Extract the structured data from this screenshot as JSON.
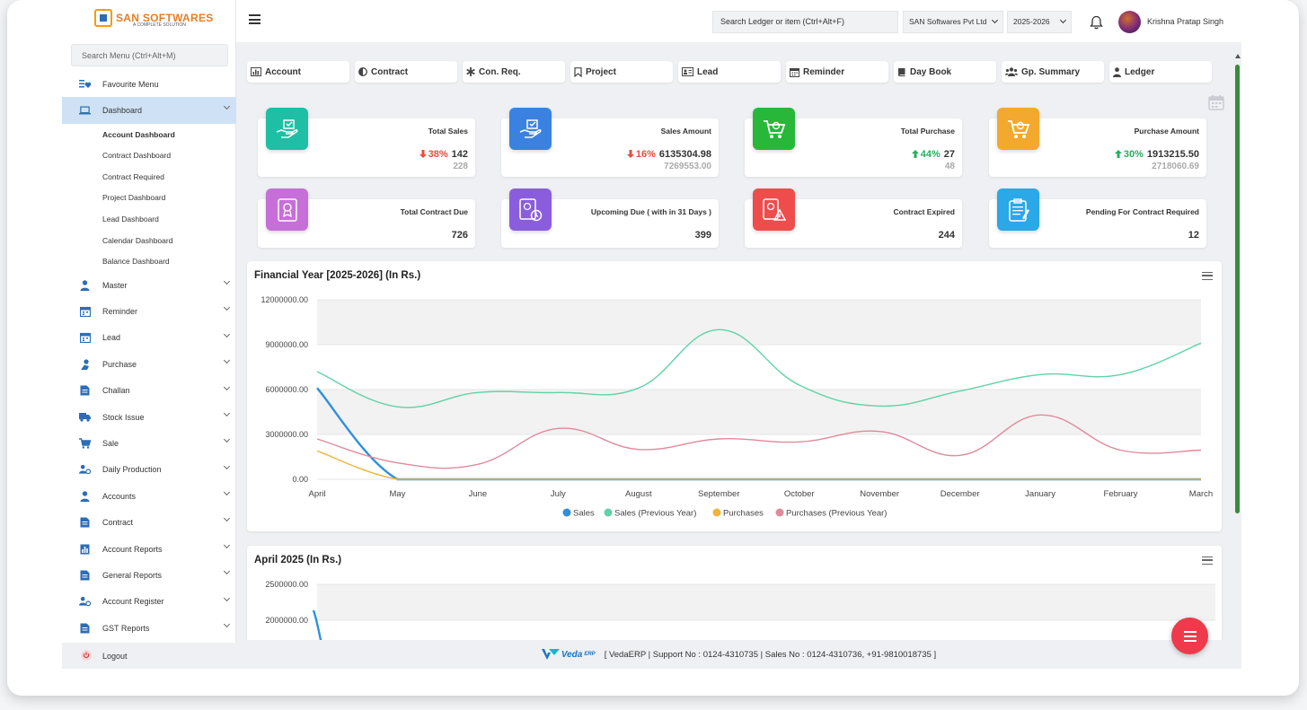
{
  "logo": {
    "text": "SAN SOFTWARES",
    "tagline": "A COMPLETE SOLUTION"
  },
  "sidebar": {
    "search_placeholder": "Search Menu (Ctrl+Alt+M)",
    "favourite": "Favourite Menu",
    "dashboard": "Dashboard",
    "dashboard_subitems": [
      "Account Dashboard",
      "Contract Dashboard",
      "Contract Required",
      "Project Dashboard",
      "Lead Dashboard",
      "Calendar Dashboard",
      "Balance Dashboard"
    ],
    "items": [
      "Master",
      "Reminder",
      "Lead",
      "Purchase",
      "Challan",
      "Stock Issue",
      "Sale",
      "Daily Production",
      "Accounts",
      "Contract",
      "Account Reports",
      "General Reports",
      "Account Register",
      "GST Reports"
    ],
    "logout": "Logout"
  },
  "topbar": {
    "search_placeholder": "Search Ledger or item (Ctrl+Alt+F)",
    "company": "SAN Softwares Pvt Ltd",
    "year": "2025-2026",
    "user": "Krishna Pratap Singh"
  },
  "tabs": [
    "Account",
    "Contract",
    "Con. Req.",
    "Project",
    "Lead",
    "Reminder",
    "Day Book",
    "Gp. Summary",
    "Ledger"
  ],
  "cards": [
    {
      "title": "Total Sales",
      "pct": "38%",
      "dir": "down",
      "value": "142",
      "prev": "228",
      "color": "#1fbfa5"
    },
    {
      "title": "Sales Amount",
      "pct": "16%",
      "dir": "down",
      "value": "6135304.98",
      "prev": "7269553.00",
      "color": "#3b82e0"
    },
    {
      "title": "Total Purchase",
      "pct": "44%",
      "dir": "up",
      "value": "27",
      "prev": "48",
      "color": "#27b83a"
    },
    {
      "title": "Purchase Amount",
      "pct": "30%",
      "dir": "up",
      "value": "1913215.50",
      "prev": "2718060.69",
      "color": "#f3a92d"
    }
  ],
  "cards2": [
    {
      "title": "Total Contract Due",
      "value": "726",
      "color": "#c66fd8"
    },
    {
      "title": "Upcoming Due ( with in 31 Days )",
      "value": "399",
      "color": "#8a5ddc"
    },
    {
      "title": "Contract Expired",
      "value": "244",
      "color": "#ef4c4c"
    },
    {
      "title": "Pending For Contract Required",
      "value": "12",
      "color": "#2aa8e8"
    }
  ],
  "chart_data": [
    {
      "type": "line",
      "title": "Financial Year [2025-2026] (In Rs.)",
      "categories": [
        "April",
        "May",
        "June",
        "July",
        "August",
        "September",
        "October",
        "November",
        "December",
        "January",
        "February",
        "March"
      ],
      "yticks": [
        "12000000.00",
        "9000000.00",
        "6000000.00",
        "3000000.00",
        "0.00"
      ],
      "ylim": [
        0,
        12000000
      ],
      "grid": true,
      "legend_position": "bottom",
      "series": [
        {
          "name": "Sales",
          "color": "#2f8fdc",
          "values": [
            6100000,
            0,
            0,
            0,
            0,
            0,
            0,
            0,
            0,
            0,
            0,
            0
          ]
        },
        {
          "name": "Sales (Previous Year)",
          "color": "#5fd3a6",
          "values": [
            7200000,
            4850000,
            5800000,
            5800000,
            6100000,
            10000000,
            6300000,
            4900000,
            5900000,
            7000000,
            7000000,
            9100000
          ]
        },
        {
          "name": "Purchases",
          "color": "#f1b43c",
          "values": [
            1900000,
            0,
            0,
            0,
            0,
            0,
            0,
            0,
            0,
            0,
            0,
            0
          ]
        },
        {
          "name": "Purchases (Previous Year)",
          "color": "#e08a9c",
          "values": [
            2700000,
            1100000,
            1000000,
            3400000,
            2000000,
            2700000,
            2500000,
            3200000,
            1600000,
            4300000,
            1950000,
            1950000
          ]
        }
      ]
    },
    {
      "type": "line",
      "title": "April 2025 (In Rs.)",
      "yticks": [
        "2500000.00",
        "2000000.00"
      ],
      "grid": true,
      "series": [
        {
          "color": "#2f8fdc"
        }
      ]
    }
  ],
  "footer": {
    "brand": "Veda",
    "brand_sub": "ERP",
    "text": "[ VedaERP | Support No : 0124-4310735 | Sales No : 0124-4310736, +91-9810018735 ]"
  },
  "icons": {
    "favourite": "heart-list-icon",
    "dashboard": "laptop-icon",
    "logout": "power-icon",
    "bell": "bell-icon",
    "calendar": "calendar-icon"
  }
}
